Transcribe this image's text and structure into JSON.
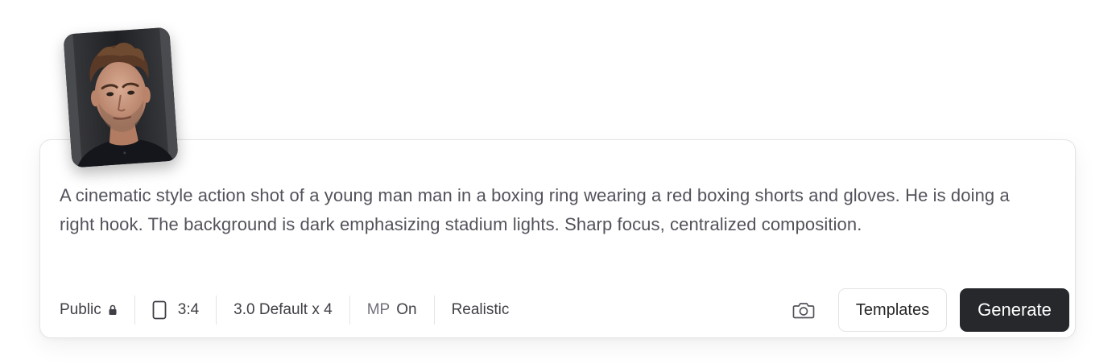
{
  "prompt": {
    "text": "A cinematic style action shot of a young man man in a boxing ring wearing a red boxing shorts and gloves. He is doing a right hook. The background is dark emphasizing stadium lights. Sharp focus, centralized composition."
  },
  "reference_image": {
    "icon": "portrait-photo"
  },
  "toolbar": {
    "visibility": {
      "label": "Public",
      "icon": "lock-icon"
    },
    "aspect_ratio": {
      "label": "3:4",
      "icon": "portrait-rectangle-icon"
    },
    "model": {
      "label": "3.0 Default x 4"
    },
    "mp": {
      "prefix": "MP",
      "value": "On"
    },
    "style": {
      "label": "Realistic"
    }
  },
  "actions": {
    "camera_icon": "camera-icon",
    "templates_label": "Templates",
    "generate_label": "Generate"
  },
  "colors": {
    "primary_button": "#27282b",
    "text": "#52525b",
    "border": "#e4e4e7"
  }
}
